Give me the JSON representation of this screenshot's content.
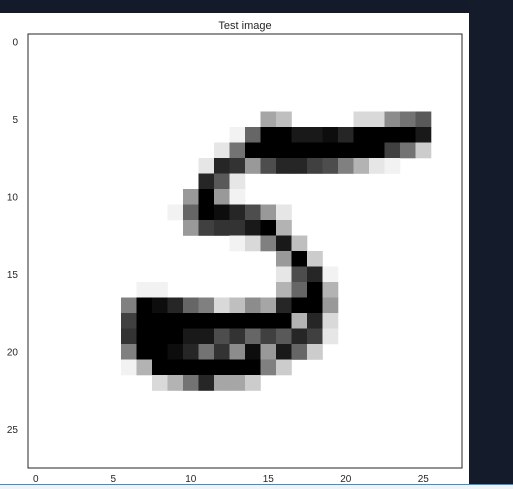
{
  "chart_data": {
    "type": "heatmap",
    "title": "Test image",
    "xlabel": "",
    "ylabel": "",
    "colormap": "gray_r",
    "grid": false,
    "x_ticks": [
      0,
      5,
      10,
      15,
      20,
      25
    ],
    "y_ticks": [
      0,
      5,
      10,
      15,
      20,
      25
    ],
    "xlim": [
      -0.5,
      27.5
    ],
    "ylim": [
      27.5,
      -0.5
    ],
    "rows": 28,
    "cols": 28,
    "value_range": [
      0,
      1
    ],
    "pixels": [
      {
        "r": 5,
        "c": 15,
        "v": 0.35
      },
      {
        "r": 5,
        "c": 16,
        "v": 0.25
      },
      {
        "r": 5,
        "c": 21,
        "v": 0.15
      },
      {
        "r": 5,
        "c": 22,
        "v": 0.15
      },
      {
        "r": 5,
        "c": 23,
        "v": 0.45
      },
      {
        "r": 5,
        "c": 24,
        "v": 0.55
      },
      {
        "r": 5,
        "c": 25,
        "v": 0.65
      },
      {
        "r": 6,
        "c": 13,
        "v": 0.05
      },
      {
        "r": 6,
        "c": 14,
        "v": 0.6
      },
      {
        "r": 6,
        "c": 15,
        "v": 1.0
      },
      {
        "r": 6,
        "c": 16,
        "v": 1.0
      },
      {
        "r": 6,
        "c": 17,
        "v": 0.9
      },
      {
        "r": 6,
        "c": 18,
        "v": 0.9
      },
      {
        "r": 6,
        "c": 19,
        "v": 0.95
      },
      {
        "r": 6,
        "c": 20,
        "v": 0.85
      },
      {
        "r": 6,
        "c": 21,
        "v": 1.0
      },
      {
        "r": 6,
        "c": 22,
        "v": 1.0
      },
      {
        "r": 6,
        "c": 23,
        "v": 1.0
      },
      {
        "r": 6,
        "c": 24,
        "v": 1.0
      },
      {
        "r": 6,
        "c": 25,
        "v": 0.9
      },
      {
        "r": 7,
        "c": 12,
        "v": 0.1
      },
      {
        "r": 7,
        "c": 13,
        "v": 0.55
      },
      {
        "r": 7,
        "c": 14,
        "v": 1.0
      },
      {
        "r": 7,
        "c": 15,
        "v": 1.0
      },
      {
        "r": 7,
        "c": 16,
        "v": 1.0
      },
      {
        "r": 7,
        "c": 17,
        "v": 1.0
      },
      {
        "r": 7,
        "c": 18,
        "v": 1.0
      },
      {
        "r": 7,
        "c": 19,
        "v": 1.0
      },
      {
        "r": 7,
        "c": 20,
        "v": 1.0
      },
      {
        "r": 7,
        "c": 21,
        "v": 1.0
      },
      {
        "r": 7,
        "c": 22,
        "v": 1.0
      },
      {
        "r": 7,
        "c": 23,
        "v": 0.75
      },
      {
        "r": 7,
        "c": 24,
        "v": 0.55
      },
      {
        "r": 7,
        "c": 25,
        "v": 0.2
      },
      {
        "r": 8,
        "c": 11,
        "v": 0.1
      },
      {
        "r": 8,
        "c": 12,
        "v": 0.85
      },
      {
        "r": 8,
        "c": 13,
        "v": 0.8
      },
      {
        "r": 8,
        "c": 14,
        "v": 0.4
      },
      {
        "r": 8,
        "c": 15,
        "v": 0.7
      },
      {
        "r": 8,
        "c": 16,
        "v": 0.85
      },
      {
        "r": 8,
        "c": 17,
        "v": 0.85
      },
      {
        "r": 8,
        "c": 18,
        "v": 0.75
      },
      {
        "r": 8,
        "c": 19,
        "v": 0.7
      },
      {
        "r": 8,
        "c": 20,
        "v": 0.5
      },
      {
        "r": 8,
        "c": 21,
        "v": 0.3
      },
      {
        "r": 8,
        "c": 22,
        "v": 0.1
      },
      {
        "r": 8,
        "c": 23,
        "v": 0.05
      },
      {
        "r": 9,
        "c": 11,
        "v": 0.85
      },
      {
        "r": 9,
        "c": 12,
        "v": 0.65
      },
      {
        "r": 9,
        "c": 13,
        "v": 0.1
      },
      {
        "r": 10,
        "c": 10,
        "v": 0.4
      },
      {
        "r": 10,
        "c": 11,
        "v": 1.0
      },
      {
        "r": 10,
        "c": 12,
        "v": 0.4
      },
      {
        "r": 10,
        "c": 13,
        "v": 0.05
      },
      {
        "r": 11,
        "c": 9,
        "v": 0.05
      },
      {
        "r": 11,
        "c": 10,
        "v": 0.6
      },
      {
        "r": 11,
        "c": 11,
        "v": 1.0
      },
      {
        "r": 11,
        "c": 12,
        "v": 0.95
      },
      {
        "r": 11,
        "c": 13,
        "v": 0.85
      },
      {
        "r": 11,
        "c": 14,
        "v": 0.7
      },
      {
        "r": 11,
        "c": 15,
        "v": 0.4
      },
      {
        "r": 11,
        "c": 16,
        "v": 0.1
      },
      {
        "r": 12,
        "c": 10,
        "v": 0.4
      },
      {
        "r": 12,
        "c": 11,
        "v": 0.75
      },
      {
        "r": 12,
        "c": 12,
        "v": 0.8
      },
      {
        "r": 12,
        "c": 13,
        "v": 0.8
      },
      {
        "r": 12,
        "c": 14,
        "v": 0.9
      },
      {
        "r": 12,
        "c": 15,
        "v": 1.0
      },
      {
        "r": 12,
        "c": 16,
        "v": 0.3
      },
      {
        "r": 13,
        "c": 13,
        "v": 0.05
      },
      {
        "r": 13,
        "c": 14,
        "v": 0.15
      },
      {
        "r": 13,
        "c": 15,
        "v": 0.5
      },
      {
        "r": 13,
        "c": 16,
        "v": 0.9
      },
      {
        "r": 13,
        "c": 17,
        "v": 0.25
      },
      {
        "r": 14,
        "c": 16,
        "v": 0.4
      },
      {
        "r": 14,
        "c": 17,
        "v": 1.0
      },
      {
        "r": 14,
        "c": 18,
        "v": 0.2
      },
      {
        "r": 15,
        "c": 16,
        "v": 0.1
      },
      {
        "r": 15,
        "c": 17,
        "v": 0.7
      },
      {
        "r": 15,
        "c": 18,
        "v": 0.85
      },
      {
        "r": 15,
        "c": 19,
        "v": 0.05
      },
      {
        "r": 16,
        "c": 7,
        "v": 0.05
      },
      {
        "r": 16,
        "c": 8,
        "v": 0.05
      },
      {
        "r": 16,
        "c": 16,
        "v": 0.3
      },
      {
        "r": 16,
        "c": 17,
        "v": 0.6
      },
      {
        "r": 16,
        "c": 18,
        "v": 1.0
      },
      {
        "r": 16,
        "c": 19,
        "v": 0.3
      },
      {
        "r": 17,
        "c": 6,
        "v": 0.5
      },
      {
        "r": 17,
        "c": 7,
        "v": 1.0
      },
      {
        "r": 17,
        "c": 8,
        "v": 0.95
      },
      {
        "r": 17,
        "c": 9,
        "v": 0.85
      },
      {
        "r": 17,
        "c": 10,
        "v": 0.6
      },
      {
        "r": 17,
        "c": 11,
        "v": 0.5
      },
      {
        "r": 17,
        "c": 12,
        "v": 0.15
      },
      {
        "r": 17,
        "c": 13,
        "v": 0.25
      },
      {
        "r": 17,
        "c": 14,
        "v": 0.45
      },
      {
        "r": 17,
        "c": 15,
        "v": 0.35
      },
      {
        "r": 17,
        "c": 16,
        "v": 0.85
      },
      {
        "r": 17,
        "c": 17,
        "v": 1.0
      },
      {
        "r": 17,
        "c": 18,
        "v": 1.0
      },
      {
        "r": 17,
        "c": 19,
        "v": 0.4
      },
      {
        "r": 18,
        "c": 6,
        "v": 0.75
      },
      {
        "r": 18,
        "c": 7,
        "v": 1.0
      },
      {
        "r": 18,
        "c": 8,
        "v": 1.0
      },
      {
        "r": 18,
        "c": 9,
        "v": 1.0
      },
      {
        "r": 18,
        "c": 10,
        "v": 1.0
      },
      {
        "r": 18,
        "c": 11,
        "v": 1.0
      },
      {
        "r": 18,
        "c": 12,
        "v": 1.0
      },
      {
        "r": 18,
        "c": 13,
        "v": 1.0
      },
      {
        "r": 18,
        "c": 14,
        "v": 1.0
      },
      {
        "r": 18,
        "c": 15,
        "v": 1.0
      },
      {
        "r": 18,
        "c": 16,
        "v": 1.0
      },
      {
        "r": 18,
        "c": 17,
        "v": 0.3
      },
      {
        "r": 18,
        "c": 18,
        "v": 0.85
      },
      {
        "r": 18,
        "c": 19,
        "v": 0.15
      },
      {
        "r": 19,
        "c": 6,
        "v": 0.8
      },
      {
        "r": 19,
        "c": 7,
        "v": 1.0
      },
      {
        "r": 19,
        "c": 8,
        "v": 1.0
      },
      {
        "r": 19,
        "c": 9,
        "v": 1.0
      },
      {
        "r": 19,
        "c": 10,
        "v": 0.9
      },
      {
        "r": 19,
        "c": 11,
        "v": 0.9
      },
      {
        "r": 19,
        "c": 12,
        "v": 0.7
      },
      {
        "r": 19,
        "c": 13,
        "v": 0.8
      },
      {
        "r": 19,
        "c": 14,
        "v": 0.6
      },
      {
        "r": 19,
        "c": 15,
        "v": 0.75
      },
      {
        "r": 19,
        "c": 16,
        "v": 0.65
      },
      {
        "r": 19,
        "c": 17,
        "v": 0.85
      },
      {
        "r": 19,
        "c": 18,
        "v": 0.75
      },
      {
        "r": 19,
        "c": 19,
        "v": 0.1
      },
      {
        "r": 20,
        "c": 6,
        "v": 0.5
      },
      {
        "r": 20,
        "c": 7,
        "v": 1.0
      },
      {
        "r": 20,
        "c": 8,
        "v": 1.0
      },
      {
        "r": 20,
        "c": 9,
        "v": 0.95
      },
      {
        "r": 20,
        "c": 10,
        "v": 0.85
      },
      {
        "r": 20,
        "c": 11,
        "v": 0.55
      },
      {
        "r": 20,
        "c": 12,
        "v": 0.8
      },
      {
        "r": 20,
        "c": 13,
        "v": 0.45
      },
      {
        "r": 20,
        "c": 14,
        "v": 0.95
      },
      {
        "r": 20,
        "c": 15,
        "v": 0.4
      },
      {
        "r": 20,
        "c": 16,
        "v": 0.9
      },
      {
        "r": 20,
        "c": 17,
        "v": 0.6
      },
      {
        "r": 20,
        "c": 18,
        "v": 0.2
      },
      {
        "r": 21,
        "c": 6,
        "v": 0.05
      },
      {
        "r": 21,
        "c": 7,
        "v": 0.3
      },
      {
        "r": 21,
        "c": 8,
        "v": 1.0
      },
      {
        "r": 21,
        "c": 9,
        "v": 1.0
      },
      {
        "r": 21,
        "c": 10,
        "v": 1.0
      },
      {
        "r": 21,
        "c": 11,
        "v": 1.0
      },
      {
        "r": 21,
        "c": 12,
        "v": 1.0
      },
      {
        "r": 21,
        "c": 13,
        "v": 1.0
      },
      {
        "r": 21,
        "c": 14,
        "v": 1.0
      },
      {
        "r": 21,
        "c": 15,
        "v": 0.5
      },
      {
        "r": 21,
        "c": 16,
        "v": 0.2
      },
      {
        "r": 22,
        "c": 8,
        "v": 0.15
      },
      {
        "r": 22,
        "c": 9,
        "v": 0.3
      },
      {
        "r": 22,
        "c": 10,
        "v": 0.55
      },
      {
        "r": 22,
        "c": 11,
        "v": 0.85
      },
      {
        "r": 22,
        "c": 12,
        "v": 0.35
      },
      {
        "r": 22,
        "c": 13,
        "v": 0.35
      },
      {
        "r": 22,
        "c": 14,
        "v": 0.2
      }
    ]
  }
}
